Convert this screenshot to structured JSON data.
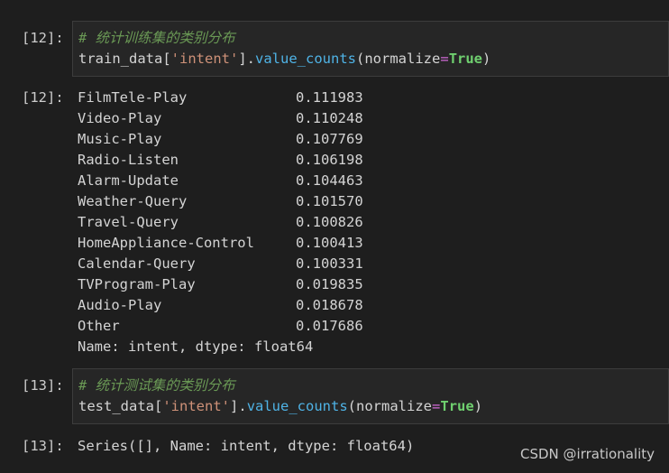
{
  "cells": [
    {
      "prompt_in": "[12]:",
      "comment": "# 统计训练集的类别分布",
      "code": {
        "var": "train_data",
        "bracket_open": "[",
        "key": "'intent'",
        "bracket_close": "]",
        "dot": ".",
        "method": "value_counts",
        "paren_open": "(",
        "arg": "normalize",
        "eq": "=",
        "val": "True",
        "paren_close": ")"
      },
      "prompt_out": "[12]:",
      "rows": [
        {
          "label": "FilmTele-Play",
          "value": "0.111983"
        },
        {
          "label": "Video-Play",
          "value": "0.110248"
        },
        {
          "label": "Music-Play",
          "value": "0.107769"
        },
        {
          "label": "Radio-Listen",
          "value": "0.106198"
        },
        {
          "label": "Alarm-Update",
          "value": "0.104463"
        },
        {
          "label": "Weather-Query",
          "value": "0.101570"
        },
        {
          "label": "Travel-Query",
          "value": "0.100826"
        },
        {
          "label": "HomeAppliance-Control",
          "value": "0.100413"
        },
        {
          "label": "Calendar-Query",
          "value": "0.100331"
        },
        {
          "label": "TVProgram-Play",
          "value": "0.019835"
        },
        {
          "label": "Audio-Play",
          "value": "0.018678"
        },
        {
          "label": "Other",
          "value": "0.017686"
        }
      ],
      "footer": "Name: intent, dtype: float64"
    },
    {
      "prompt_in": "[13]:",
      "comment": "# 统计测试集的类别分布",
      "code": {
        "var": "test_data",
        "bracket_open": "[",
        "key": "'intent'",
        "bracket_close": "]",
        "dot": ".",
        "method": "value_counts",
        "paren_open": "(",
        "arg": "normalize",
        "eq": "=",
        "val": "True",
        "paren_close": ")"
      },
      "prompt_out": "[13]:",
      "footer": "Series([], Name: intent, dtype: float64)"
    }
  ],
  "watermark": "CSDN @irrationality"
}
